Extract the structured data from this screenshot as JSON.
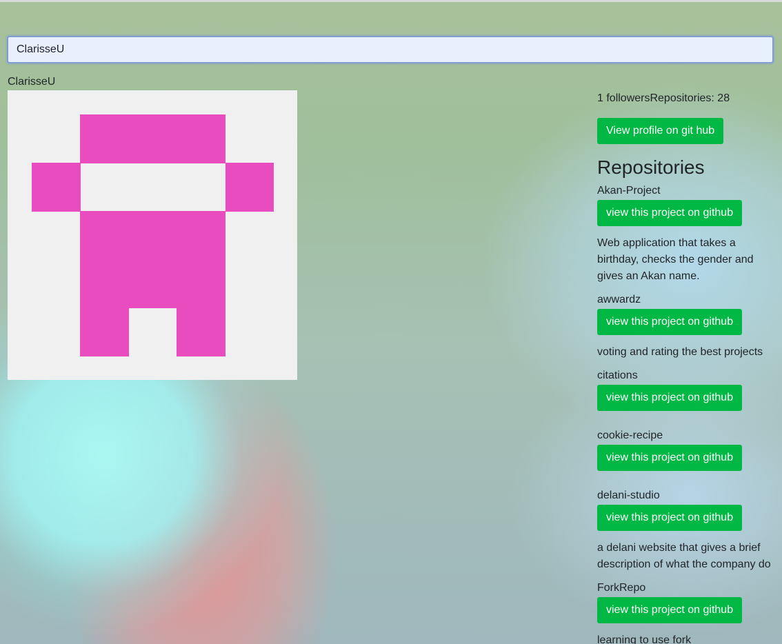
{
  "search": {
    "value": "ClarisseU",
    "placeholder": ""
  },
  "profile": {
    "username": "ClarisseU",
    "stats": "1 followersRepositories: 28",
    "view_profile_label": "View profile on git hub",
    "avatar_color": "#e84cbe"
  },
  "repos": {
    "heading": "Repositories",
    "button_label": "view this project on github",
    "items": [
      {
        "name": "Akan-Project",
        "description": "Web application that takes a birthday, checks the gender and gives an Akan name."
      },
      {
        "name": "awwardz",
        "description": "voting and rating the best projects"
      },
      {
        "name": "citations",
        "description": ""
      },
      {
        "name": "cookie-recipe",
        "description": ""
      },
      {
        "name": "delani-studio",
        "description": "a delani website that gives a brief description of what the company do"
      },
      {
        "name": "ForkRepo",
        "description": "learning to use fork"
      }
    ]
  },
  "colors": {
    "button": "#00b843",
    "avatar_bg": "#f0f0f0"
  }
}
